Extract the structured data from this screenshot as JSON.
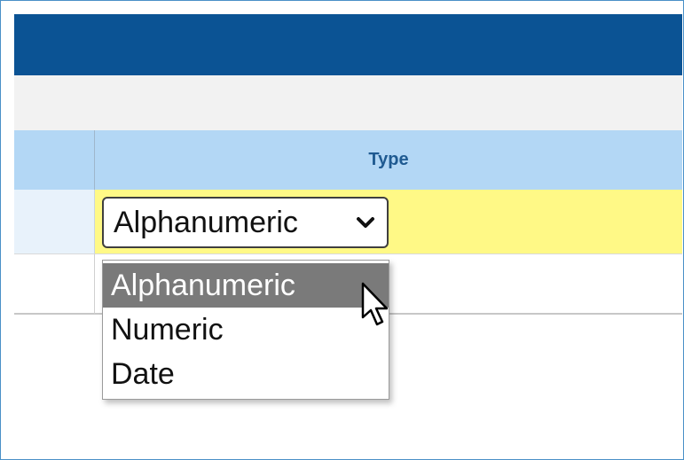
{
  "table": {
    "type_header": "Type"
  },
  "type_select": {
    "value": "Alphanumeric",
    "options": [
      "Alphanumeric",
      "Numeric",
      "Date"
    ],
    "highlighted_option": "Alphanumeric"
  },
  "colors": {
    "header_bar": "#0b5394",
    "column_header": "#b3d7f5",
    "column_header_text": "#1f5a91",
    "selected_row": "#fff986",
    "highlighted_option": "#7a7a7a"
  },
  "icons": {
    "select_arrow": "chevron-down-icon",
    "pointer": "mouse-pointer-icon"
  }
}
